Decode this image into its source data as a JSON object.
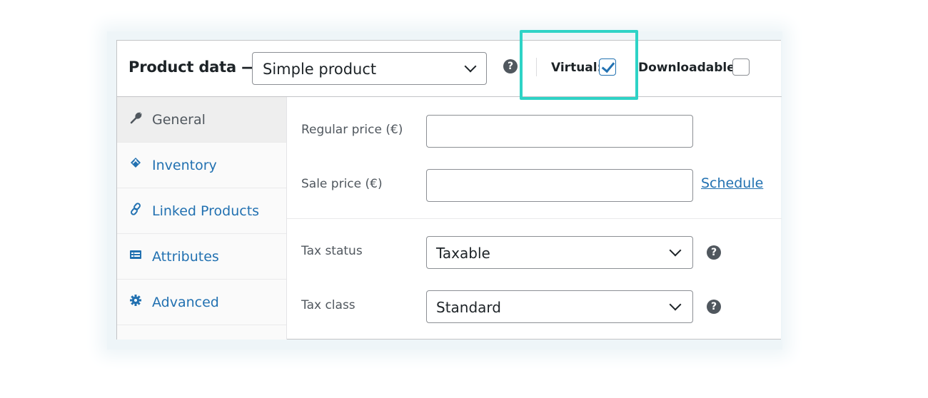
{
  "header": {
    "title": "Product data —",
    "product_type": "Simple product",
    "help_glyph": "?",
    "virtual_label": "Virtual:",
    "virtual_checked": true,
    "downloadable_label": "Downloadable:",
    "downloadable_checked": false
  },
  "sidebar": {
    "items": [
      {
        "label": "General",
        "icon": "wrench-icon",
        "active": true
      },
      {
        "label": "Inventory",
        "icon": "tag-icon",
        "active": false
      },
      {
        "label": "Linked Products",
        "icon": "link-icon",
        "active": false
      },
      {
        "label": "Attributes",
        "icon": "list-card-icon",
        "active": false
      },
      {
        "label": "Advanced",
        "icon": "gear-icon",
        "active": false
      }
    ]
  },
  "form": {
    "regular_price": {
      "label": "Regular price (€)",
      "value": ""
    },
    "sale_price": {
      "label": "Sale price (€)",
      "value": ""
    },
    "schedule_link": "Schedule",
    "tax_status": {
      "label": "Tax status",
      "value": "Taxable"
    },
    "tax_class": {
      "label": "Tax class",
      "value": "Standard"
    }
  },
  "colors": {
    "accent_link": "#2271b1",
    "highlight": "#2ed3c6",
    "border": "#8c8f94",
    "help_icon": "#50575e"
  }
}
